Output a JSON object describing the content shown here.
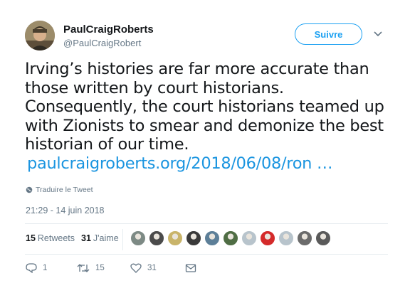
{
  "profile": {
    "name": "PaulCraigRoberts",
    "handle": "@PaulCraigRobert",
    "follow_label": "Suivre"
  },
  "tweet": {
    "lines": [
      "Irving’s histories are far more accurate than",
      "those written by court historians.",
      "Consequently, the court historians teamed up",
      "with Zionists to smear and demonize the best",
      "historian of our time."
    ],
    "link": "paulcraigroberts.org/2018/06/08/ron …",
    "translate_label": "Traduire le Tweet",
    "timestamp": "21:29 - 14 juin 2018"
  },
  "stats": {
    "retweets_count": "15",
    "retweets_label": "Retweets",
    "likes_count": "31",
    "likes_label": "J'aime"
  },
  "likers": [
    {
      "color": "#7d8a85",
      "icon": "liker-avatar"
    },
    {
      "color": "#4b4b4b",
      "icon": "liker-avatar"
    },
    {
      "color": "#c9b46a",
      "icon": "liker-avatar"
    },
    {
      "color": "#3a3a3a",
      "icon": "liker-avatar"
    },
    {
      "color": "#5d7f98",
      "icon": "liker-avatar"
    },
    {
      "color": "#4f6d44",
      "icon": "liker-avatar"
    },
    {
      "color": "#b8c4cc",
      "icon": "liker-avatar"
    },
    {
      "color": "#d42a2a",
      "icon": "liker-avatar"
    },
    {
      "color": "#b8c4cc",
      "icon": "liker-avatar"
    },
    {
      "color": "#6b6b6b",
      "icon": "liker-avatar"
    },
    {
      "color": "#5a5a5a",
      "icon": "liker-avatar"
    }
  ],
  "actions": {
    "reply_count": "1",
    "retweet_count": "15",
    "like_count": "31"
  },
  "colors": {
    "accent": "#1da1f2",
    "link": "#1b95e0",
    "muted": "#657786",
    "text": "#14171a"
  }
}
